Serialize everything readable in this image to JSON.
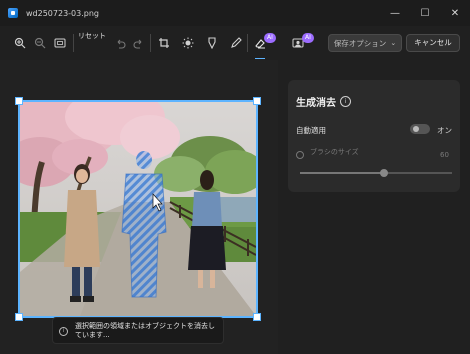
{
  "window": {
    "title": "wd250723-03.png",
    "minimize": "—",
    "maximize": "☐",
    "close": "✕"
  },
  "toolbar": {
    "reset_label": "リセット",
    "ai_badge_1": "AI",
    "ai_badge_2": "AI",
    "save_label": "保存オプション",
    "save_chevron": "⌄",
    "cancel_label": "キャンセル"
  },
  "panel": {
    "title": "生成消去",
    "info": "i",
    "auto_apply_label": "自動適用",
    "auto_apply_state": "オン",
    "brush_size_label": "ブラシのサイズ",
    "brush_size_value": "60",
    "brush_size_fraction": 0.55
  },
  "tooltip": {
    "icon": "i",
    "text": "選択範囲の領域またはオブジェクトを消去しています..."
  },
  "colors": {
    "accent": "#5db4ff",
    "ai_badge": "#9c6cff"
  }
}
